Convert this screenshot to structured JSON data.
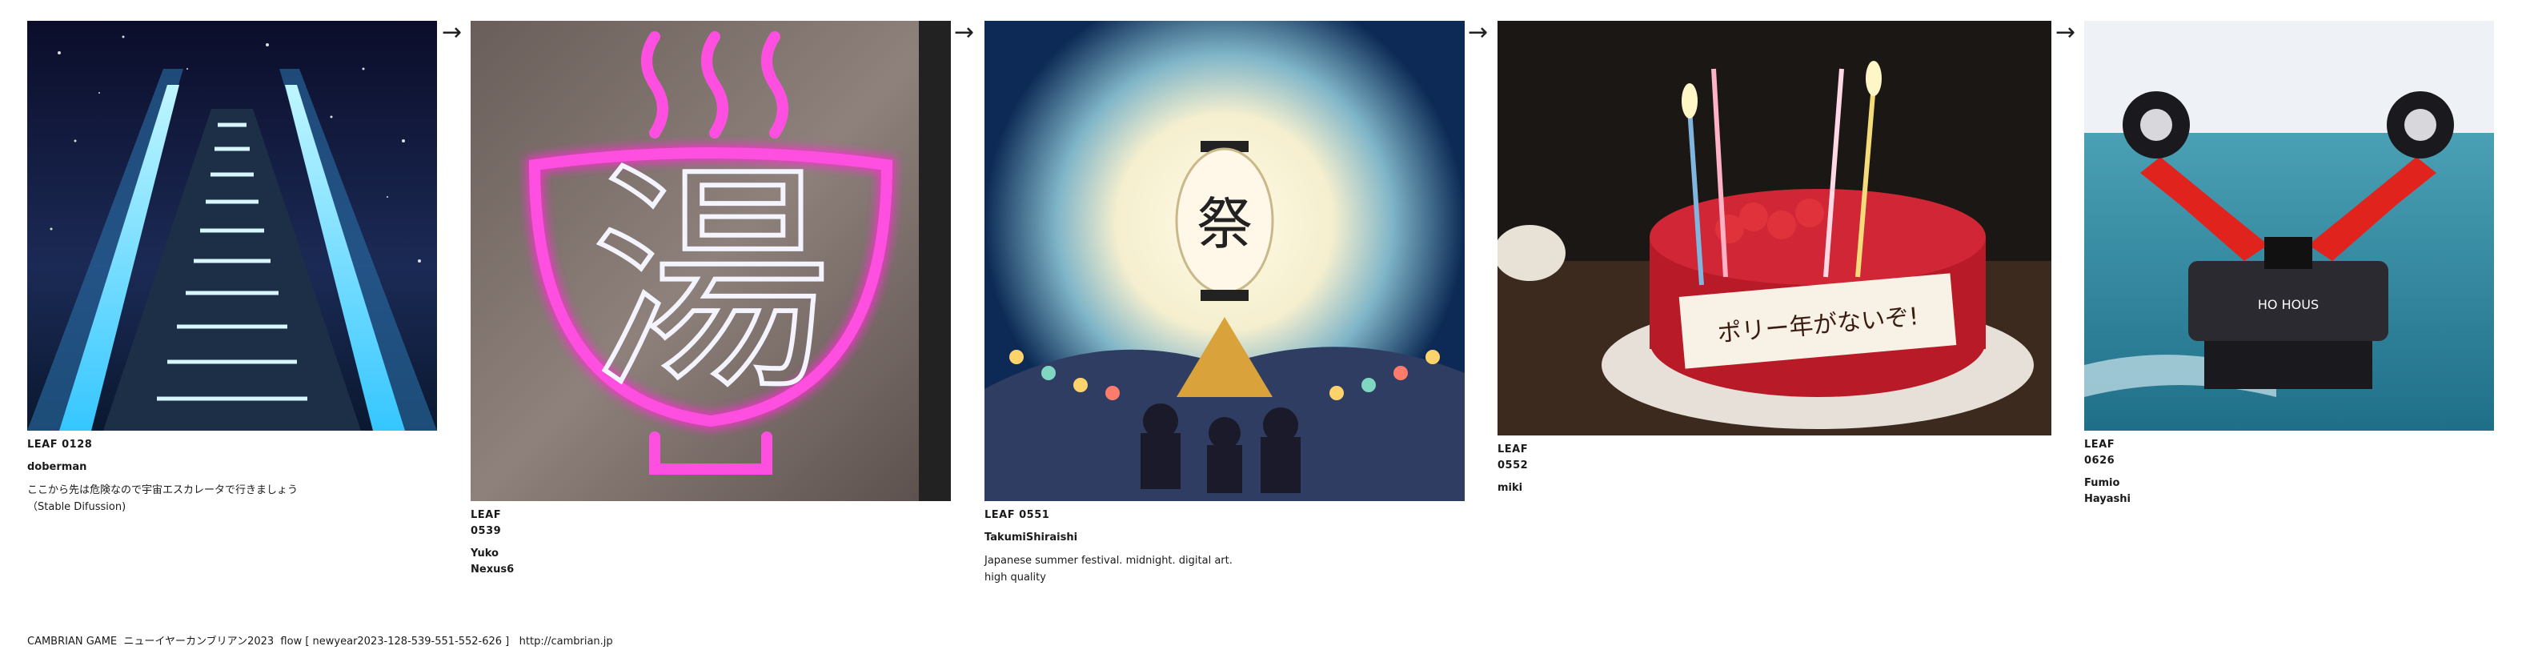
{
  "leaves": [
    {
      "id": "LEAF 0128",
      "author": "doberman",
      "description": "ここから先は危険なので宇宙エスカレータで行きましょう（Stable Difussion)",
      "image": "space-escalator"
    },
    {
      "id": "LEAF 0539",
      "author": "Yuko Nexus6",
      "description": "",
      "image": "neon-yu-sign",
      "sign_glyph": "湯"
    },
    {
      "id": "LEAF 0551",
      "author": "TakumiShiraishi",
      "description": "Japanese summer festival. midnight. digital art. high quality",
      "image": "summer-festival-lantern",
      "lantern_glyph": "祭"
    },
    {
      "id": "LEAF 0552",
      "author": "miki",
      "description": "",
      "image": "birthday-cake",
      "plaque_text": "ポリー年がないぞ!"
    },
    {
      "id": "LEAF 0626",
      "author": "Fumio Hayashi",
      "description": "",
      "image": "robot-in-sea",
      "robot_text": "HO HOUS"
    }
  ],
  "arrow_symbol": "→",
  "footer": {
    "text": "CAMBRIAN GAME  ニューイヤーカンブリアン2023  flow [ newyear2023-128-539-551-552-626 ]",
    "url": "http://cambrian.jp"
  }
}
